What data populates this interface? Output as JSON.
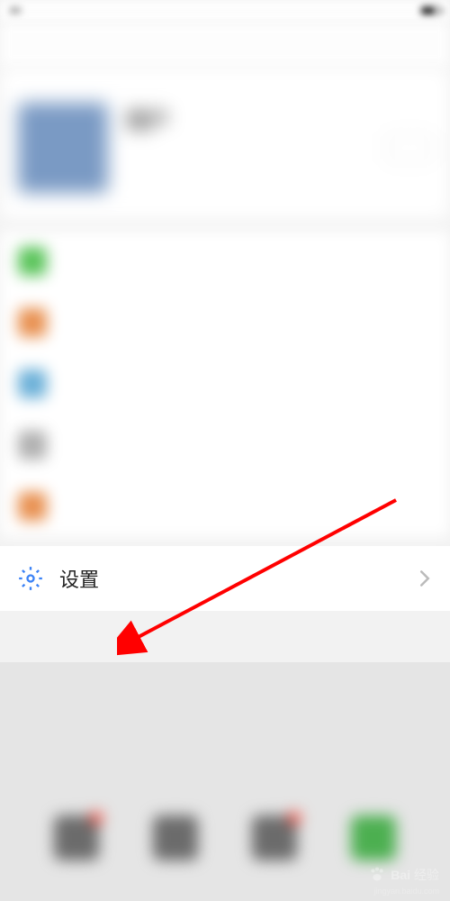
{
  "statusbar": {
    "time": "30"
  },
  "profile": {
    "name": "用户",
    "sub1": "",
    "sub2": ""
  },
  "settings": {
    "label": "设置"
  },
  "watermark": {
    "brand_a": "Bai",
    "brand_b": "经验",
    "url": "jingyan.baidu.com"
  }
}
